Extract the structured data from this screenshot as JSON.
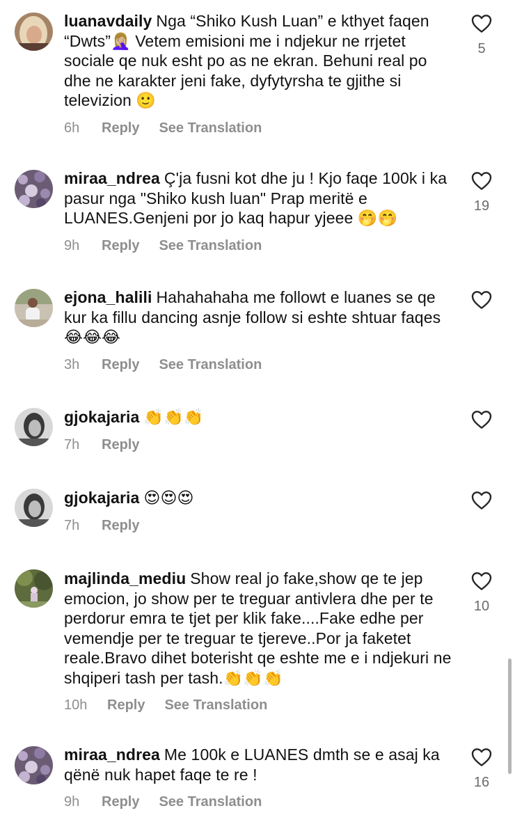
{
  "comments": [
    {
      "username": "luanavdaily",
      "text": "Nga “Shiko Kush Luan” e kthyet faqen “Dwts”🤦🏼‍♀️ Vetem emisioni me i ndjekur ne rrjetet sociale qe nuk esht po as ne ekran. Behuni real po dhe ne karakter jeni fake, dyfytyrsha te gjithe si televizion 🙂",
      "time": "6h",
      "reply": "Reply",
      "translate": "See Translation",
      "likes": "5",
      "avatar": "avatar-blonde"
    },
    {
      "username": "miraa_ndrea",
      "text": "Ç'ja fusni kot dhe ju ! Kjo faqe 100k i ka pasur nga \"Shiko kush luan\" Prap meritë e LUANES.Genjeni por jo kaq hapur yjeee 🤭🤭",
      "time": "9h",
      "reply": "Reply",
      "translate": "See Translation",
      "likes": "19",
      "avatar": "avatar-flowers"
    },
    {
      "username": "ejona_halili",
      "text": "Hahahahaha me followt e luanes se qe kur ka fillu dancing asnje follow si eshte shtuar faqes 😂😂😂",
      "time": "3h",
      "reply": "Reply",
      "translate": "See Translation",
      "likes": "",
      "avatar": "avatar-outdoor"
    },
    {
      "username": "gjokajaria",
      "text": "👏👏👏",
      "time": "7h",
      "reply": "Reply",
      "translate": "",
      "likes": "",
      "avatar": "avatar-bw"
    },
    {
      "username": "gjokajaria",
      "text": "😍😍😍",
      "time": "7h",
      "reply": "Reply",
      "translate": "",
      "likes": "",
      "avatar": "avatar-bw"
    },
    {
      "username": "majlinda_mediu",
      "text": "Show real jo fake,show qe te jep emocion, jo show per te treguar antivlera dhe per te perdorur emra te tjet per klik fake....Fake edhe per vemendje per te treguar  te tjereve..Por ja faketet reale.Bravo dihet boterisht qe eshte me e i ndjekuri ne shqiperi tash per tash.👏👏👏",
      "time": "10h",
      "reply": "Reply",
      "translate": "See Translation",
      "likes": "10",
      "avatar": "avatar-garden"
    },
    {
      "username": "miraa_ndrea",
      "text": "Me 100k e LUANES dmth se e asaj ka qënë nuk hapet faqe te re !",
      "time": "9h",
      "reply": "Reply",
      "translate": "See Translation",
      "likes": "16",
      "avatar": "avatar-flowers"
    }
  ],
  "icons": {
    "like": "heart-outline-icon"
  },
  "colors": {
    "text": "#111111",
    "meta": "#8e8e8e",
    "background": "#ffffff"
  }
}
